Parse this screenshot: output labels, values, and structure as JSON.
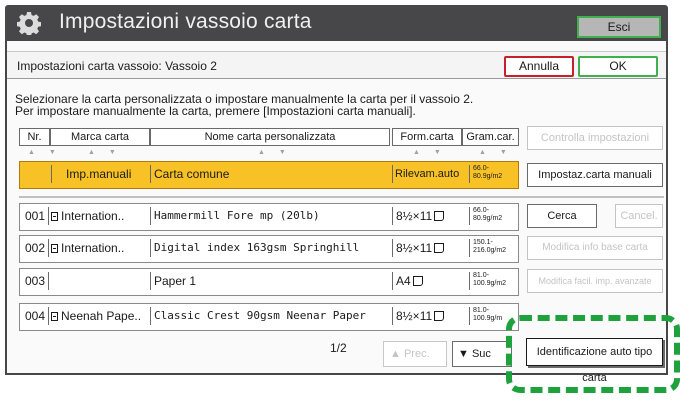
{
  "header": {
    "title": "Impostazioni vassoio carta",
    "exit_label": "Esci"
  },
  "dialog": {
    "subtitle": "Impostazioni carta vassoio: Vassoio 2",
    "cancel_label": "Annulla",
    "ok_label": "OK",
    "instruction_line1": "Selezionare la carta personalizzata o impostare manualmente la carta per il vassoio 2.",
    "instruction_line2": "Per impostare manualmente la carta, premere [Impostazioni carta manuali]."
  },
  "table": {
    "columns": [
      "Nr.",
      "Marca carta",
      "Nome carta personalizzata",
      "Form.carta",
      "Gram.car."
    ],
    "manual_row": {
      "brand": "Imp.manuali",
      "name": "Carta comune",
      "size": "Rilevam.auto",
      "gram_line1": "66.0-",
      "gram_line2": "80.9g/m2"
    },
    "rows": [
      {
        "nr": "001",
        "brand": "Internation..",
        "name": "Hammermill Fore mp (20lb)",
        "size": "8½×11",
        "gram_line1": "66.0-",
        "gram_line2": "80.9g/m2"
      },
      {
        "nr": "002",
        "brand": "Internation..",
        "name": "Digital index 163gsm Springhill",
        "size": "8½×11",
        "gram_line1": "150.1-",
        "gram_line2": "216.0g/m2"
      },
      {
        "nr": "003",
        "brand": "",
        "name": "Paper 1",
        "size": "A4",
        "gram_line1": "81.0-",
        "gram_line2": "100.9g/m2"
      },
      {
        "nr": "004",
        "brand": "Neenah Pape..",
        "name": "Classic Crest 90gsm  Neenar Paper",
        "size": "8½×11",
        "gram_line1": "81.0-",
        "gram_line2": "100.9g/m"
      }
    ]
  },
  "side": {
    "check_settings": "Controlla impostazioni",
    "manual_paper": "Impostaz.carta manuali",
    "search": "Cerca",
    "cancel": "Cancel.",
    "modify_base": "Modifica info base carta",
    "modify_advanced": "Modifica facil. imp. avanzate"
  },
  "pager": {
    "page": "1/2",
    "prev": "Prec.",
    "next": "Suc"
  },
  "auto_detect_label": "Identificazione auto tipo carta",
  "colors": {
    "titlebar": "#47474a",
    "selected_row": "#f8c227",
    "highlight": "#1fa23e"
  }
}
